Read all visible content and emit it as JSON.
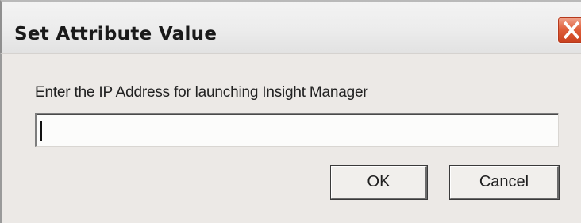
{
  "dialog": {
    "title": "Set Attribute Value",
    "prompt": "Enter the IP Address for launching Insight Manager",
    "input_value": "",
    "ok_label": "OK",
    "cancel_label": "Cancel",
    "close_icon": "close-icon"
  },
  "colors": {
    "close_button": "#d9532f",
    "dialog_background": "#ece9e6"
  }
}
